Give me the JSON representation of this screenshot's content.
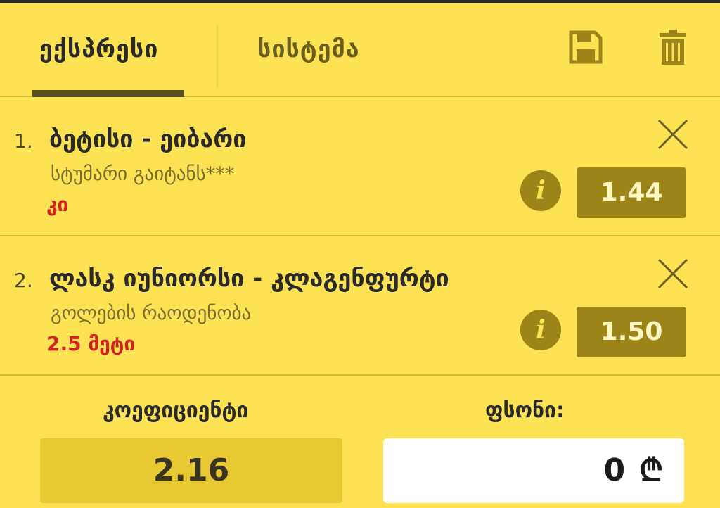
{
  "tabs": {
    "express": "ექსპრესი",
    "system": "სისტემა"
  },
  "header_icons": {
    "save": "save-icon",
    "delete": "trash-icon"
  },
  "bets": [
    {
      "num": "1.",
      "title": "ბეტისი - ეიბარი",
      "market": "სტუმარი გაიტანს***",
      "pick": "კი",
      "odds": "1.44"
    },
    {
      "num": "2.",
      "title": "ლასკ იუნიორსი - კლაგენფურტი",
      "market": "გოლების რაოდენობა",
      "pick": "2.5 მეტი",
      "odds": "1.50"
    }
  ],
  "footer": {
    "coef_label": "კოეფიციენტი",
    "coef_value": "2.16",
    "stake_label": "ფსონი:",
    "stake_value": "0",
    "currency": "₾"
  },
  "colors": {
    "background": "#fde254",
    "accent": "#9c8419",
    "pick": "#d2221d"
  }
}
